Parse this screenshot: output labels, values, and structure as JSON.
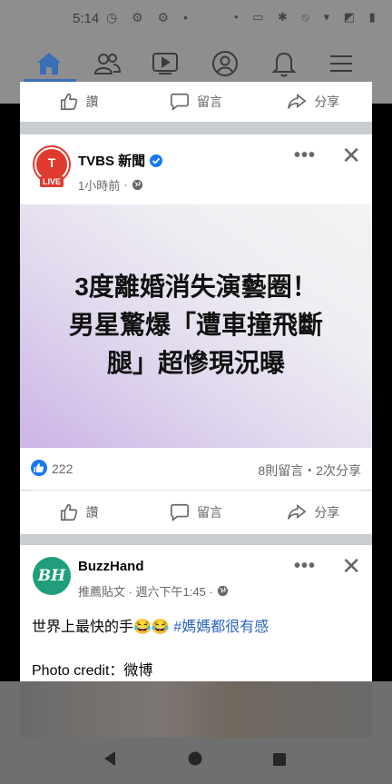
{
  "status_bar": {
    "time": "5:14"
  },
  "prev_post_actions": {
    "like": "讚",
    "comment": "留言",
    "share": "分享"
  },
  "post1": {
    "page_name": "TVBS 新聞",
    "logo_badge": "LIVE",
    "time": "1小時前",
    "headline_line1": "3度離婚消失演藝圈！",
    "headline_line2": "男星驚爆「遭車撞飛斷",
    "headline_line3": "腿」超慘現況曝",
    "like_count": "222",
    "stats": "8則留言・2次分享",
    "actions": {
      "like": "讚",
      "comment": "留言",
      "share": "分享"
    }
  },
  "post2": {
    "page_name": "BuzzHand",
    "avatar_text": "BH",
    "meta": "推薦貼文 · 週六下午1:45 ·",
    "text_main": "世界上最快的手😂😂 ",
    "hashtag": "#媽媽都很有感",
    "photo_credit": "Photo credit：微博"
  },
  "colors": {
    "facebook_blue": "#1877f2",
    "tvbs_red": "#e03a2f",
    "buzzhand_green": "#1f9e7c"
  }
}
